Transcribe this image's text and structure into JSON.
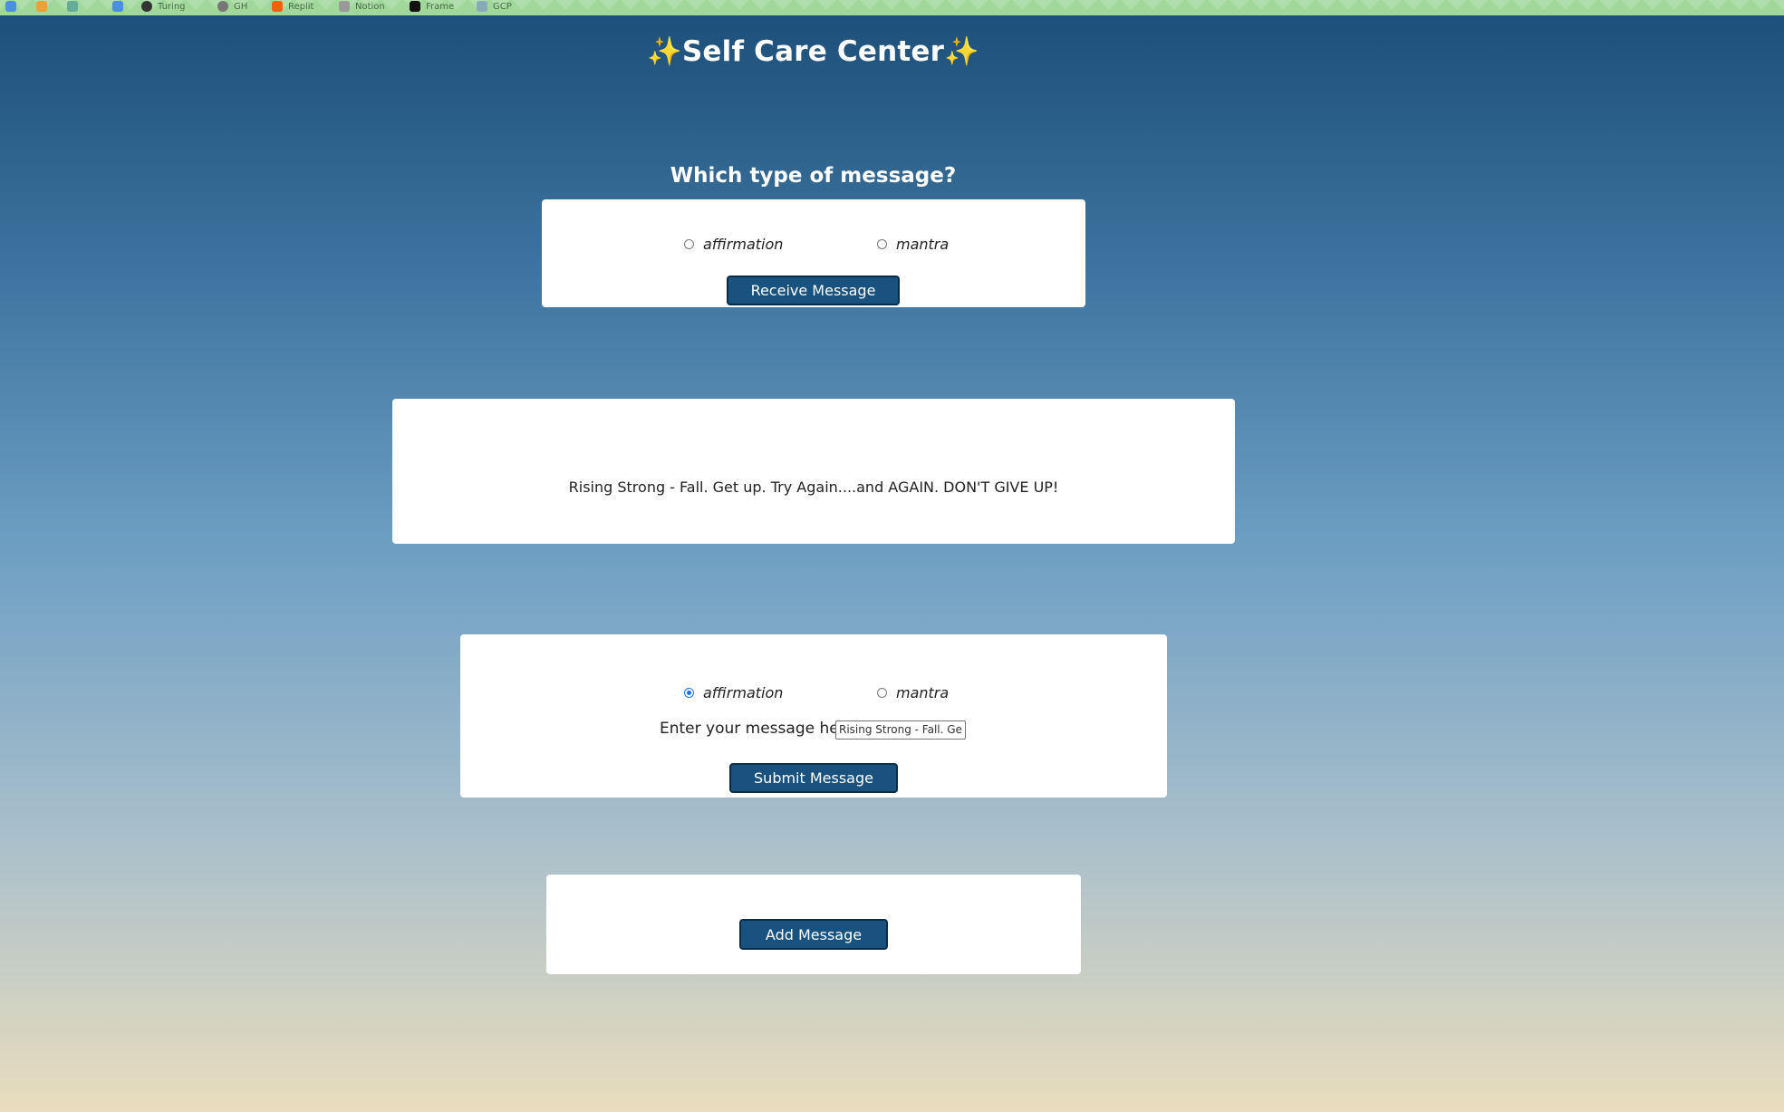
{
  "bookmarks": [
    {
      "label": "",
      "icon": "calendar-icon",
      "color": "#5a9"
    },
    {
      "label": "",
      "icon": "docs-icon",
      "color": "#4a8fe0"
    },
    {
      "label": "Turing",
      "icon": "turing-icon",
      "color": "#333"
    },
    {
      "label": "GH",
      "icon": "github-icon",
      "color": "#555"
    },
    {
      "label": "Replit",
      "icon": "replit-icon",
      "color": "#f26207"
    },
    {
      "label": "Notion",
      "icon": "notion-icon",
      "color": "#777"
    },
    {
      "label": "Frame",
      "icon": "frame-icon",
      "color": "#111"
    },
    {
      "label": "GCP",
      "icon": "gcp-icon",
      "color": "#8ab"
    }
  ],
  "header": {
    "sparkle_left": "✨",
    "title": "Self Care Center",
    "sparkle_right": "✨"
  },
  "receive": {
    "question": "Which type of message?",
    "option_affirmation": "affirmation",
    "option_mantra": "mantra",
    "selected": "none",
    "button_label": "Receive Message"
  },
  "display": {
    "message": "Rising Strong - Fall. Get up. Try Again....and AGAIN. DON'T GIVE UP!"
  },
  "submit_form": {
    "option_affirmation": "affirmation",
    "option_mantra": "mantra",
    "selected": "affirmation",
    "input_label": "Enter your message here:",
    "input_value": "Rising Strong - Fall. Ge",
    "button_label": "Submit Message"
  },
  "add": {
    "button_label": "Add Message"
  },
  "colors": {
    "button_bg": "#19527f",
    "radio_checked": "#1a73e8",
    "sparkle": "#f3d44a"
  }
}
